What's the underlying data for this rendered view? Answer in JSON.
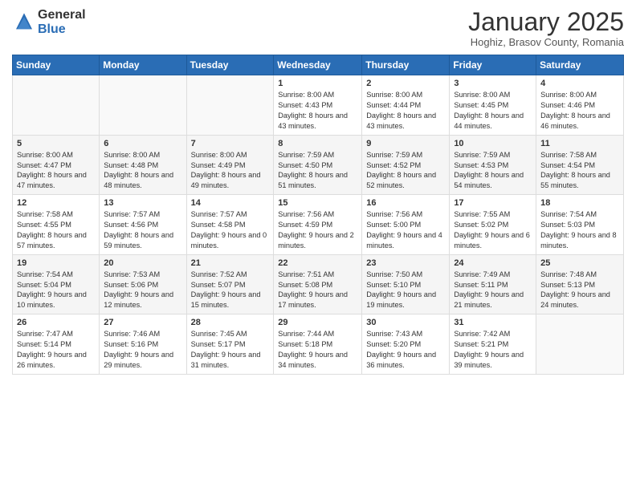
{
  "header": {
    "logo_general": "General",
    "logo_blue": "Blue",
    "month": "January 2025",
    "location": "Hoghiz, Brasov County, Romania"
  },
  "weekdays": [
    "Sunday",
    "Monday",
    "Tuesday",
    "Wednesday",
    "Thursday",
    "Friday",
    "Saturday"
  ],
  "weeks": [
    [
      {
        "day": "",
        "info": ""
      },
      {
        "day": "",
        "info": ""
      },
      {
        "day": "",
        "info": ""
      },
      {
        "day": "1",
        "info": "Sunrise: 8:00 AM\nSunset: 4:43 PM\nDaylight: 8 hours and 43 minutes."
      },
      {
        "day": "2",
        "info": "Sunrise: 8:00 AM\nSunset: 4:44 PM\nDaylight: 8 hours and 43 minutes."
      },
      {
        "day": "3",
        "info": "Sunrise: 8:00 AM\nSunset: 4:45 PM\nDaylight: 8 hours and 44 minutes."
      },
      {
        "day": "4",
        "info": "Sunrise: 8:00 AM\nSunset: 4:46 PM\nDaylight: 8 hours and 46 minutes."
      }
    ],
    [
      {
        "day": "5",
        "info": "Sunrise: 8:00 AM\nSunset: 4:47 PM\nDaylight: 8 hours and 47 minutes."
      },
      {
        "day": "6",
        "info": "Sunrise: 8:00 AM\nSunset: 4:48 PM\nDaylight: 8 hours and 48 minutes."
      },
      {
        "day": "7",
        "info": "Sunrise: 8:00 AM\nSunset: 4:49 PM\nDaylight: 8 hours and 49 minutes."
      },
      {
        "day": "8",
        "info": "Sunrise: 7:59 AM\nSunset: 4:50 PM\nDaylight: 8 hours and 51 minutes."
      },
      {
        "day": "9",
        "info": "Sunrise: 7:59 AM\nSunset: 4:52 PM\nDaylight: 8 hours and 52 minutes."
      },
      {
        "day": "10",
        "info": "Sunrise: 7:59 AM\nSunset: 4:53 PM\nDaylight: 8 hours and 54 minutes."
      },
      {
        "day": "11",
        "info": "Sunrise: 7:58 AM\nSunset: 4:54 PM\nDaylight: 8 hours and 55 minutes."
      }
    ],
    [
      {
        "day": "12",
        "info": "Sunrise: 7:58 AM\nSunset: 4:55 PM\nDaylight: 8 hours and 57 minutes."
      },
      {
        "day": "13",
        "info": "Sunrise: 7:57 AM\nSunset: 4:56 PM\nDaylight: 8 hours and 59 minutes."
      },
      {
        "day": "14",
        "info": "Sunrise: 7:57 AM\nSunset: 4:58 PM\nDaylight: 9 hours and 0 minutes."
      },
      {
        "day": "15",
        "info": "Sunrise: 7:56 AM\nSunset: 4:59 PM\nDaylight: 9 hours and 2 minutes."
      },
      {
        "day": "16",
        "info": "Sunrise: 7:56 AM\nSunset: 5:00 PM\nDaylight: 9 hours and 4 minutes."
      },
      {
        "day": "17",
        "info": "Sunrise: 7:55 AM\nSunset: 5:02 PM\nDaylight: 9 hours and 6 minutes."
      },
      {
        "day": "18",
        "info": "Sunrise: 7:54 AM\nSunset: 5:03 PM\nDaylight: 9 hours and 8 minutes."
      }
    ],
    [
      {
        "day": "19",
        "info": "Sunrise: 7:54 AM\nSunset: 5:04 PM\nDaylight: 9 hours and 10 minutes."
      },
      {
        "day": "20",
        "info": "Sunrise: 7:53 AM\nSunset: 5:06 PM\nDaylight: 9 hours and 12 minutes."
      },
      {
        "day": "21",
        "info": "Sunrise: 7:52 AM\nSunset: 5:07 PM\nDaylight: 9 hours and 15 minutes."
      },
      {
        "day": "22",
        "info": "Sunrise: 7:51 AM\nSunset: 5:08 PM\nDaylight: 9 hours and 17 minutes."
      },
      {
        "day": "23",
        "info": "Sunrise: 7:50 AM\nSunset: 5:10 PM\nDaylight: 9 hours and 19 minutes."
      },
      {
        "day": "24",
        "info": "Sunrise: 7:49 AM\nSunset: 5:11 PM\nDaylight: 9 hours and 21 minutes."
      },
      {
        "day": "25",
        "info": "Sunrise: 7:48 AM\nSunset: 5:13 PM\nDaylight: 9 hours and 24 minutes."
      }
    ],
    [
      {
        "day": "26",
        "info": "Sunrise: 7:47 AM\nSunset: 5:14 PM\nDaylight: 9 hours and 26 minutes."
      },
      {
        "day": "27",
        "info": "Sunrise: 7:46 AM\nSunset: 5:16 PM\nDaylight: 9 hours and 29 minutes."
      },
      {
        "day": "28",
        "info": "Sunrise: 7:45 AM\nSunset: 5:17 PM\nDaylight: 9 hours and 31 minutes."
      },
      {
        "day": "29",
        "info": "Sunrise: 7:44 AM\nSunset: 5:18 PM\nDaylight: 9 hours and 34 minutes."
      },
      {
        "day": "30",
        "info": "Sunrise: 7:43 AM\nSunset: 5:20 PM\nDaylight: 9 hours and 36 minutes."
      },
      {
        "day": "31",
        "info": "Sunrise: 7:42 AM\nSunset: 5:21 PM\nDaylight: 9 hours and 39 minutes."
      },
      {
        "day": "",
        "info": ""
      }
    ]
  ]
}
